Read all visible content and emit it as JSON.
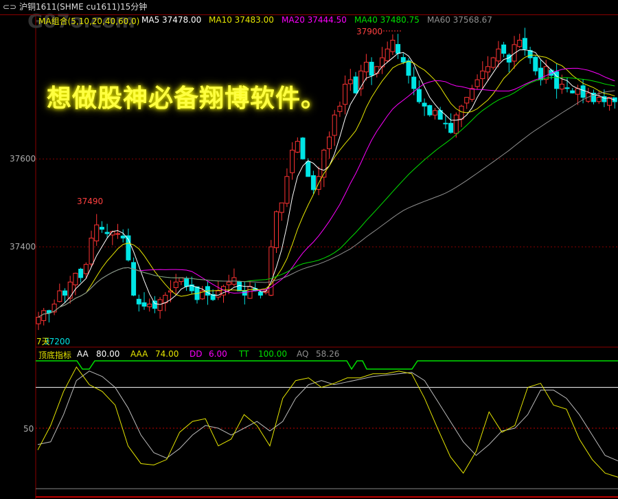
{
  "title": {
    "icon": "link-icon",
    "text": "沪铜1611(SHME cu1611)15分钟"
  },
  "watermark": "G07o.com",
  "ma_legend": {
    "group": "MA组合(5,10,20,40,60,0)",
    "ma5": "MA5 37478.00",
    "ma10": "MA10 37483.00",
    "ma20": "MA20 37444.50",
    "ma40": "MA40 37480.75",
    "ma60": "MA60 37568.67"
  },
  "colors": {
    "ma5": "#ffffff",
    "ma10": "#e6e600",
    "ma20": "#ff00ff",
    "ma40": "#00e000",
    "ma60": "#909090",
    "up": "#ff3333",
    "down": "#00e5e5",
    "grid": "#8b0000"
  },
  "price_axis": {
    "labels": [
      "37600",
      "37400"
    ],
    "values": [
      37600,
      37400
    ]
  },
  "annotations": {
    "high": "37900",
    "local_high": "37490",
    "low": "37200",
    "days": "7天"
  },
  "slogan": "想做股神必备翔博软件。",
  "indicator": {
    "name": "顶底指标",
    "aa_label": "AA",
    "aa": "80.00",
    "aaa_label": "AAA",
    "aaa": "74.00",
    "dd_label": "DD",
    "dd": "6.00",
    "tt_label": "TT",
    "tt": "100.00",
    "aq_label": "AQ",
    "aq": "58.26",
    "axis_label": "50"
  },
  "chart_data": {
    "type": "candlestick",
    "closes": [
      37240,
      37255,
      37250,
      37270,
      37300,
      37290,
      37320,
      37340,
      37330,
      37360,
      37420,
      37450,
      37440,
      37430,
      37435,
      37430,
      37420,
      37370,
      37290,
      37270,
      37265,
      37270,
      37260,
      37280,
      37290,
      37300,
      37320,
      37330,
      37310,
      37300,
      37280,
      37300,
      37290,
      37280,
      37300,
      37310,
      37320,
      37330,
      37300,
      37290,
      37310,
      37300,
      37290,
      37300,
      37400,
      37480,
      37500,
      37560,
      37620,
      37640,
      37600,
      37560,
      37530,
      37560,
      37620,
      37650,
      37700,
      37720,
      37770,
      37780,
      37750,
      37800,
      37820,
      37790,
      37810,
      37830,
      37850,
      37870,
      37840,
      37820,
      37790,
      37760,
      37730,
      37720,
      37700,
      37710,
      37690,
      37680,
      37660,
      37700,
      37720,
      37740,
      37760,
      37780,
      37800,
      37810,
      37830,
      37850,
      37840,
      37820,
      37860,
      37870,
      37850,
      37830,
      37800,
      37780,
      37810,
      37790,
      37760,
      37770,
      37760,
      37750,
      37760,
      37740,
      37750,
      37730,
      37740,
      37730,
      37740,
      37730
    ],
    "ylim": [
      37172,
      37927
    ],
    "indicator_yellow": [
      34,
      52,
      77,
      95,
      82,
      77,
      67,
      37,
      24,
      23,
      27,
      47,
      55,
      57,
      37,
      42,
      60,
      52,
      37,
      72,
      85,
      87,
      80,
      83,
      87,
      87,
      90,
      90,
      92,
      90,
      72,
      50,
      29,
      17,
      33,
      62,
      47,
      52,
      80,
      83,
      67,
      64,
      42,
      27,
      17,
      14
    ],
    "indicator_white": [
      38,
      40,
      60,
      85,
      92,
      88,
      80,
      65,
      45,
      32,
      28,
      35,
      45,
      52,
      50,
      45,
      50,
      55,
      48,
      55,
      72,
      82,
      85,
      82,
      84,
      86,
      88,
      89,
      90,
      91,
      85,
      70,
      55,
      40,
      30,
      38,
      48,
      50,
      60,
      78,
      78,
      72,
      60,
      45,
      30,
      26
    ],
    "indicator_ylim": [
      0,
      100
    ],
    "indicator_levels": {
      "tt": 100,
      "aa": 80,
      "mid": 50
    }
  }
}
